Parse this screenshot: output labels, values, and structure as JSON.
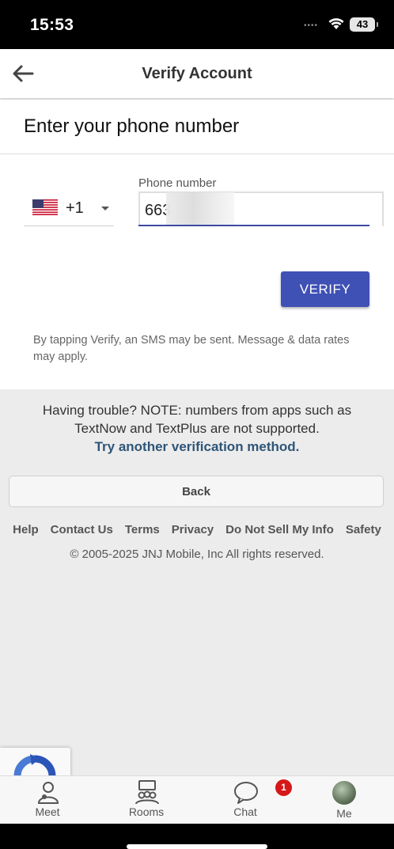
{
  "status_bar": {
    "time": "15:53",
    "battery": "43",
    "signal_dots": "••••"
  },
  "header": {
    "title": "Verify Account",
    "back_icon": "arrow-left-icon"
  },
  "form": {
    "title": "Enter your phone number",
    "country_code": "+1",
    "country_flag": "us-flag",
    "phone_label": "Phone number",
    "phone_value": "663",
    "verify_label": "VERIFY",
    "disclaimer": "By tapping Verify, an SMS may be sent. Message & data rates may apply."
  },
  "help": {
    "trouble_text": "Having trouble? NOTE: numbers from apps such as TextNow and TextPlus are not supported.",
    "alt_method_link": "Try another verification method.",
    "back_label": "Back"
  },
  "footer": {
    "links": [
      "Help",
      "Contact Us",
      "Terms",
      "Privacy",
      "Do Not Sell My Info",
      "Safety"
    ],
    "copyright": "© 2005-2025 JNJ Mobile, Inc All rights reserved."
  },
  "bottom_nav": {
    "items": [
      {
        "label": "Meet",
        "icon": "meet-icon"
      },
      {
        "label": "Rooms",
        "icon": "rooms-icon"
      },
      {
        "label": "Chat",
        "icon": "chat-bubble-icon"
      },
      {
        "label": "Me",
        "icon": "avatar"
      }
    ],
    "chat_badge": "1"
  },
  "colors": {
    "accent": "#3f51b5",
    "link": "#2e5578",
    "badge": "#d51818"
  }
}
